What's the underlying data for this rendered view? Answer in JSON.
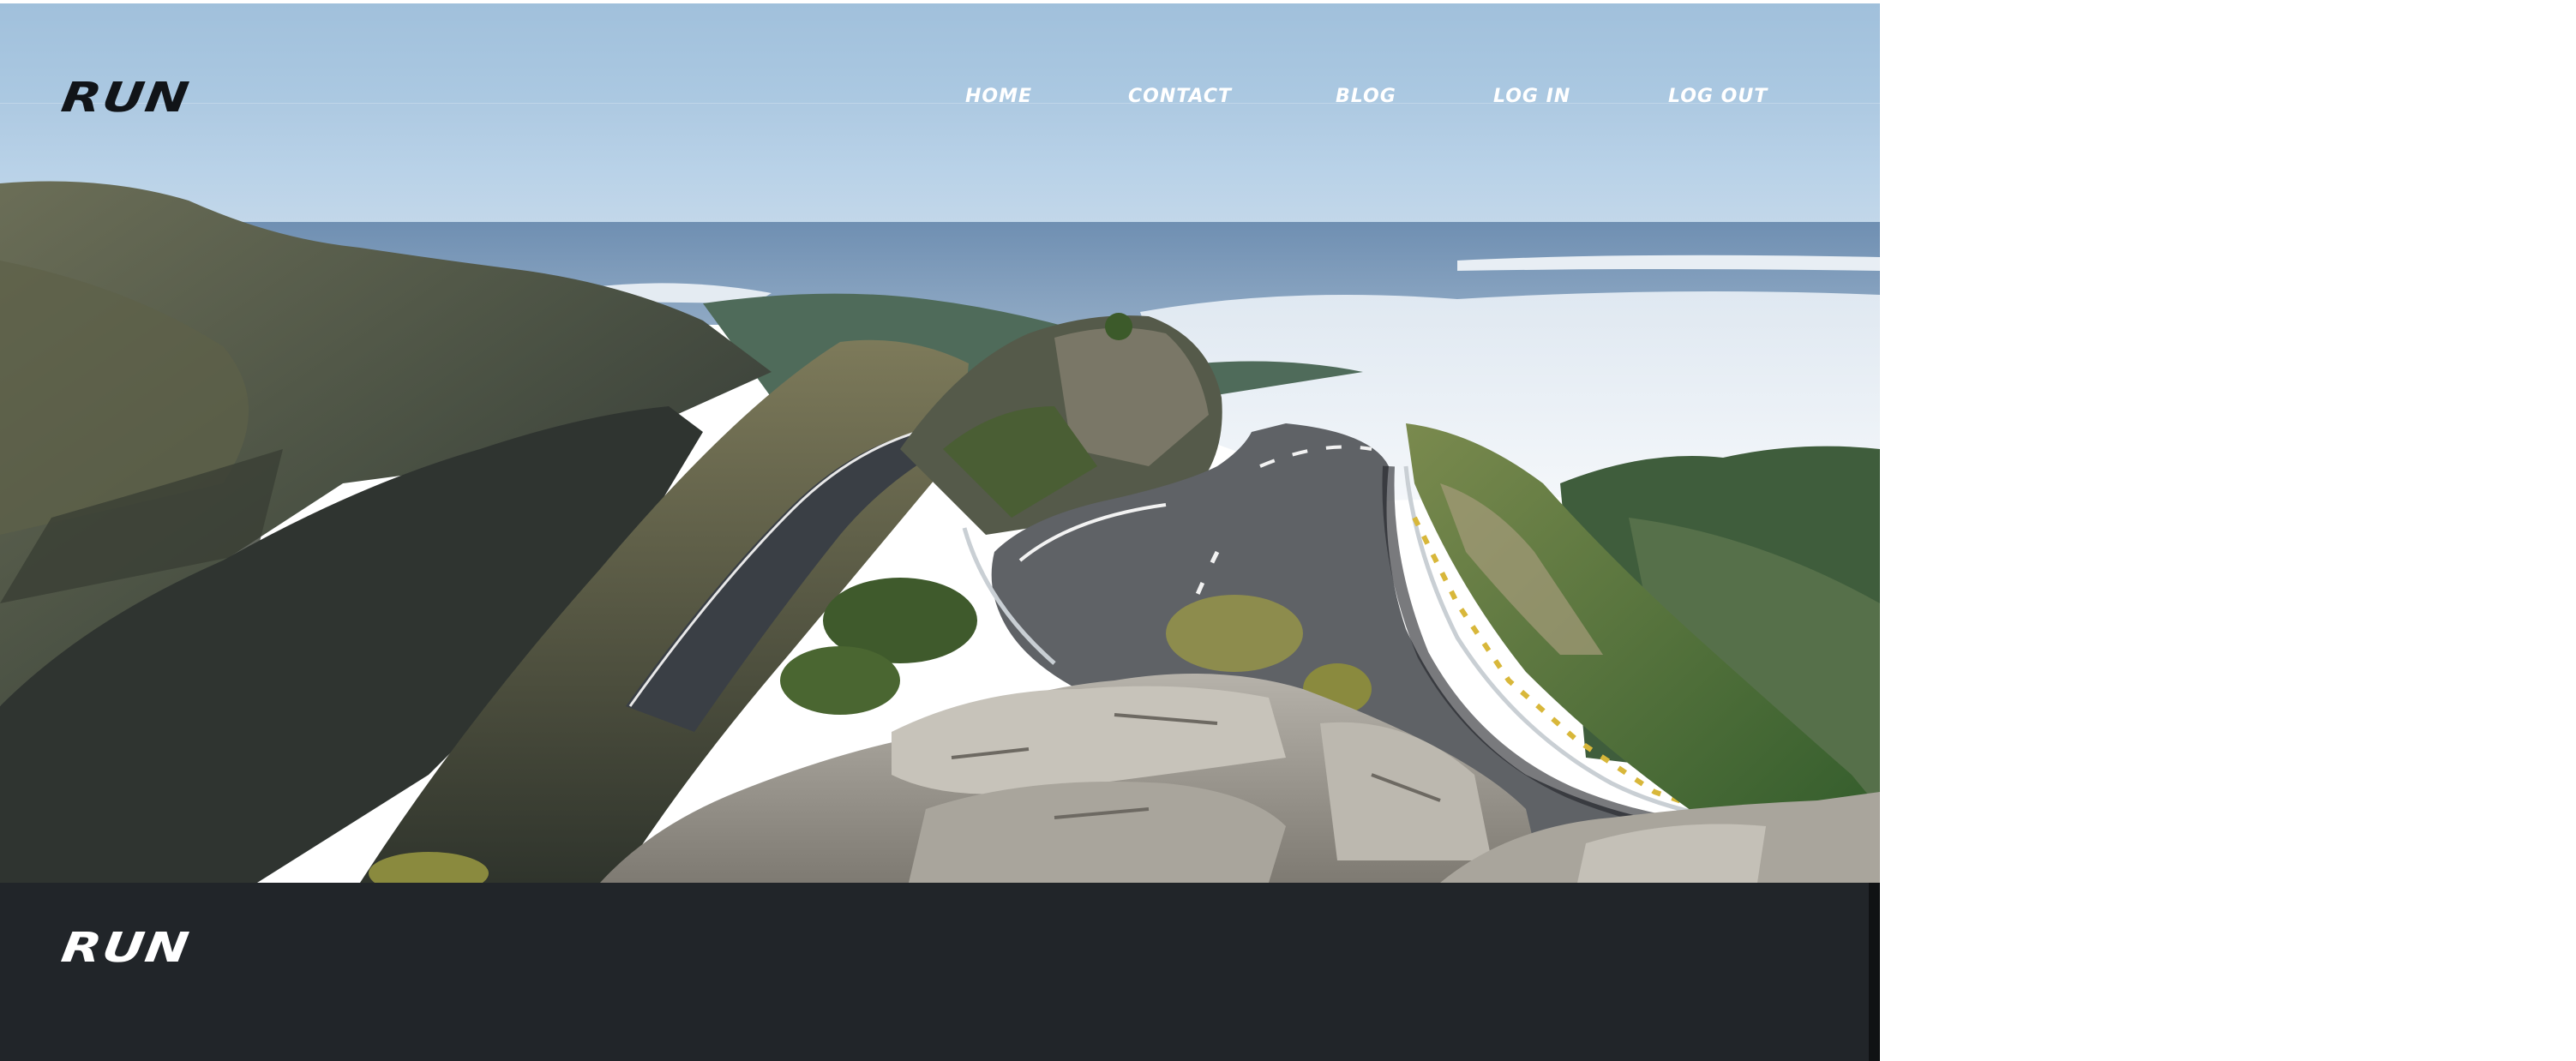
{
  "header": {
    "logo_text": "RUN",
    "nav": [
      {
        "label": "HOME"
      },
      {
        "label": "CONTACT"
      },
      {
        "label": "BLOG"
      },
      {
        "label": "LOG IN"
      },
      {
        "label": "LOG OUT"
      }
    ]
  },
  "hero": {
    "image_subject": "winding mountain road above the clouds"
  },
  "footer": {
    "logo_text": "RUN",
    "background_color": "#212529"
  }
}
